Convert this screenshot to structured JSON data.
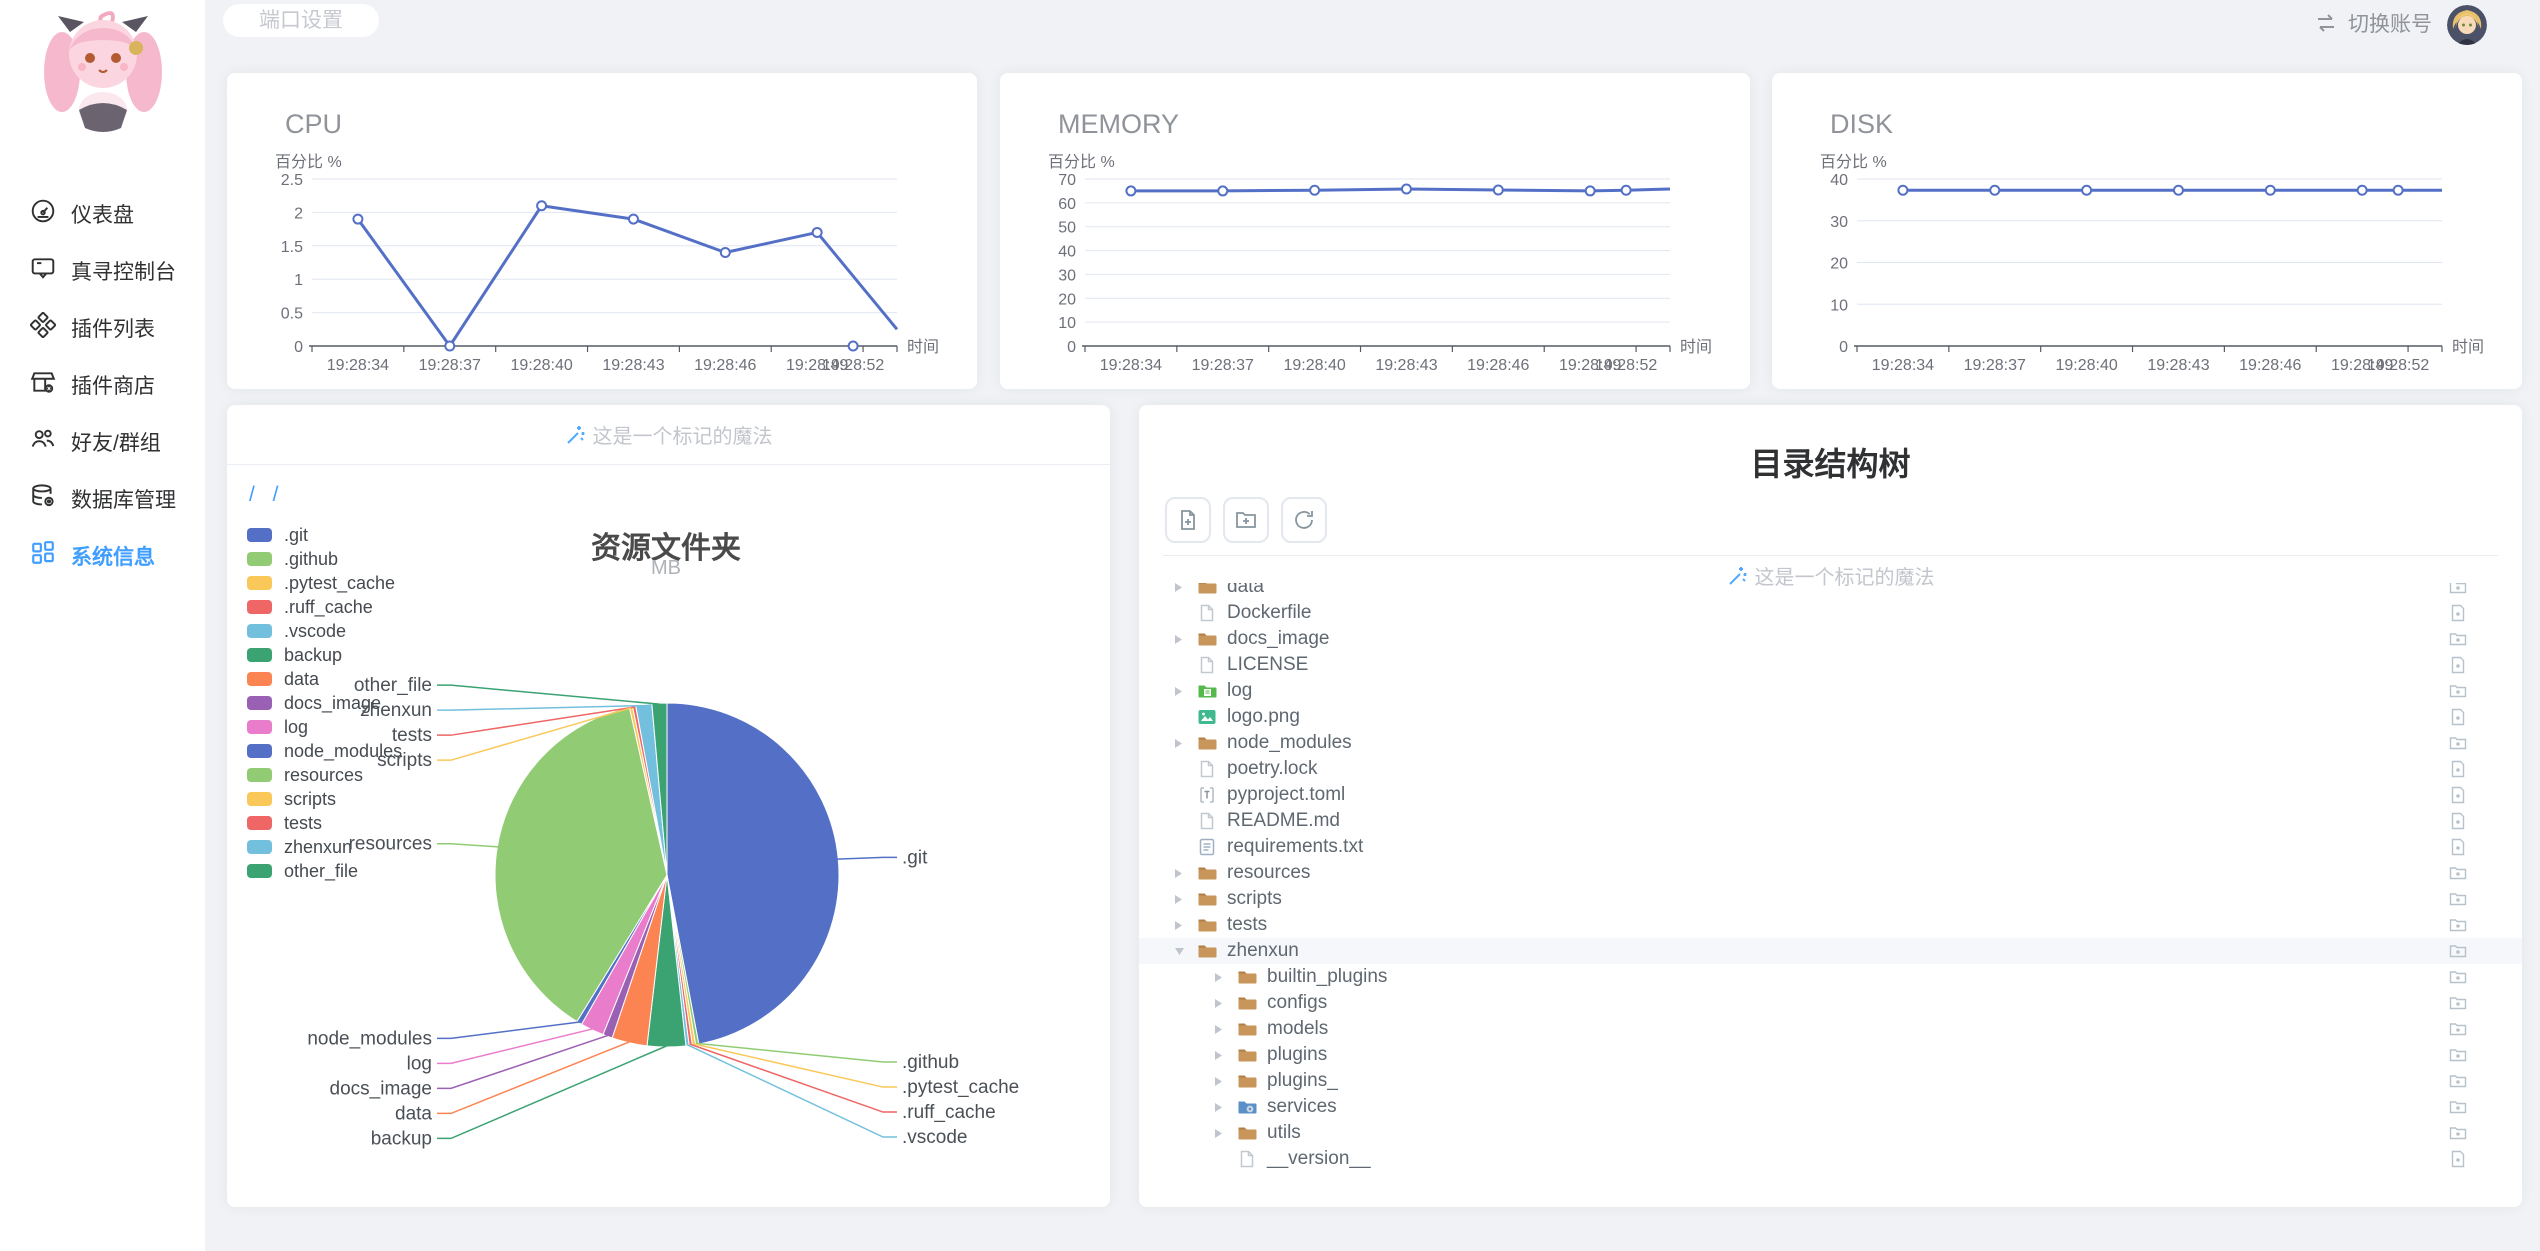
{
  "topbar": {
    "port_button": "端口设置",
    "switch_account": "切换账号"
  },
  "sidebar": {
    "items": [
      {
        "label": "仪表盘",
        "icon": "gauge-icon",
        "active": false
      },
      {
        "label": "真寻控制台",
        "icon": "console-icon",
        "active": false
      },
      {
        "label": "插件列表",
        "icon": "plugins-icon",
        "active": false
      },
      {
        "label": "插件商店",
        "icon": "store-icon",
        "active": false
      },
      {
        "label": "好友/群组",
        "icon": "friends-icon",
        "active": false
      },
      {
        "label": "数据库管理",
        "icon": "database-icon",
        "active": false
      },
      {
        "label": "系统信息",
        "icon": "grid-icon",
        "active": true
      }
    ]
  },
  "chart_data": [
    {
      "type": "line",
      "title": "CPU",
      "ylabel": "百分比 %",
      "xlabel": "时间",
      "x": [
        "19:28:34",
        "19:28:37",
        "19:28:40",
        "19:28:43",
        "19:28:46",
        "19:28:49",
        "19:28:52"
      ],
      "values": [
        1.9,
        0,
        2.1,
        1.9,
        1.4,
        1.7,
        0
      ],
      "ylim": [
        0,
        2.5
      ],
      "yticks": [
        0,
        0.5,
        1,
        1.5,
        2,
        2.5
      ],
      "x_fractions": [
        0.0785,
        0.2355,
        0.3925,
        0.5495,
        0.7065,
        0.8635,
        0.925
      ],
      "tick_fractions": [
        0,
        0.157,
        0.314,
        0.471,
        0.628,
        0.785,
        0.942,
        1
      ],
      "tail": {
        "f": 1,
        "v": 0.25
      },
      "detached_last": true,
      "color": "#5470c6",
      "grid": true,
      "legend_position": "none"
    },
    {
      "type": "line",
      "title": "MEMORY",
      "ylabel": "百分比 %",
      "xlabel": "时间",
      "x": [
        "19:28:34",
        "19:28:37",
        "19:28:40",
        "19:28:43",
        "19:28:46",
        "19:28:49",
        "19:28:52"
      ],
      "values": [
        65,
        65,
        65.3,
        65.8,
        65.4,
        65,
        65.3
      ],
      "ylim": [
        0,
        70
      ],
      "yticks": [
        0,
        10,
        20,
        30,
        40,
        50,
        60,
        70
      ],
      "x_fractions": [
        0.0785,
        0.2355,
        0.3925,
        0.5495,
        0.7065,
        0.8635,
        0.925
      ],
      "tick_fractions": [
        0,
        0.157,
        0.314,
        0.471,
        0.628,
        0.785,
        0.942,
        1
      ],
      "tail": {
        "f": 1,
        "v": 65.8
      },
      "detached_last": false,
      "color": "#5470c6",
      "grid": true,
      "legend_position": "none"
    },
    {
      "type": "line",
      "title": "DISK",
      "ylabel": "百分比 %",
      "xlabel": "时间",
      "x": [
        "19:28:34",
        "19:28:37",
        "19:28:40",
        "19:28:43",
        "19:28:46",
        "19:28:49",
        "19:28:52"
      ],
      "values": [
        37.3,
        37.3,
        37.3,
        37.3,
        37.3,
        37.3,
        37.3
      ],
      "ylim": [
        0,
        40
      ],
      "yticks": [
        0,
        10,
        20,
        30,
        40
      ],
      "x_fractions": [
        0.0785,
        0.2355,
        0.3925,
        0.5495,
        0.7065,
        0.8635,
        0.925
      ],
      "tick_fractions": [
        0,
        0.157,
        0.314,
        0.471,
        0.628,
        0.785,
        0.942,
        1
      ],
      "tail": {
        "f": 1,
        "v": 37.3
      },
      "detached_last": false,
      "color": "#5470c6",
      "grid": true,
      "legend_position": "none"
    },
    {
      "type": "pie",
      "title": "资源文件夹",
      "subtitle": "MB",
      "unit": "MB",
      "legend_position": "left",
      "items": [
        {
          "label": ".git",
          "value_pct": 46.9,
          "color": "#5470c6"
        },
        {
          "label": ".github",
          "value_pct": 0.3,
          "color": "#91cc75"
        },
        {
          "label": ".pytest_cache",
          "value_pct": 0.3,
          "color": "#fac858"
        },
        {
          "label": ".ruff_cache",
          "value_pct": 0.3,
          "color": "#ee6666"
        },
        {
          "label": ".vscode",
          "value_pct": 0.3,
          "color": "#73c0de"
        },
        {
          "label": "backup",
          "value_pct": 3.6,
          "color": "#3ba272"
        },
        {
          "label": "data",
          "value_pct": 3.3,
          "color": "#fc8452"
        },
        {
          "label": "docs_image",
          "value_pct": 0.9,
          "color": "#9a60b4"
        },
        {
          "label": "log",
          "value_pct": 2.2,
          "color": "#ea7ccc"
        },
        {
          "label": "node_modules",
          "value_pct": 0.5,
          "color": "#5470c6"
        },
        {
          "label": "resources",
          "value_pct": 37.6,
          "color": "#91cc75"
        },
        {
          "label": "scripts",
          "value_pct": 0.3,
          "color": "#fac858"
        },
        {
          "label": "tests",
          "value_pct": 0.3,
          "color": "#ee6666"
        },
        {
          "label": "zhenxun",
          "value_pct": 1.5,
          "color": "#73c0de"
        },
        {
          "label": "other_file",
          "value_pct": 1.4,
          "color": "#3ba272"
        }
      ]
    }
  ],
  "resource_card": {
    "marker_text": "这是一个标记的魔法",
    "breadcrumb": "/ /"
  },
  "tree_card": {
    "title": "目录结构树",
    "marker_text": "这是一个标记的魔法",
    "rows": [
      {
        "name": "data",
        "icon": "folder",
        "dir": true,
        "level": 0
      },
      {
        "name": "Dockerfile",
        "icon": "file",
        "dir": false,
        "level": 0
      },
      {
        "name": "docs_image",
        "icon": "folder",
        "dir": true,
        "level": 0
      },
      {
        "name": "LICENSE",
        "icon": "file",
        "dir": false,
        "level": 0
      },
      {
        "name": "log",
        "icon": "folder-log",
        "dir": true,
        "level": 0
      },
      {
        "name": "logo.png",
        "icon": "image",
        "dir": false,
        "level": 0
      },
      {
        "name": "node_modules",
        "icon": "folder",
        "dir": true,
        "level": 0
      },
      {
        "name": "poetry.lock",
        "icon": "file",
        "dir": false,
        "level": 0
      },
      {
        "name": "pyproject.toml",
        "icon": "toml",
        "dir": false,
        "level": 0
      },
      {
        "name": "README.md",
        "icon": "file",
        "dir": false,
        "level": 0
      },
      {
        "name": "requirements.txt",
        "icon": "txt",
        "dir": false,
        "level": 0
      },
      {
        "name": "resources",
        "icon": "folder",
        "dir": true,
        "level": 0
      },
      {
        "name": "scripts",
        "icon": "folder",
        "dir": true,
        "level": 0
      },
      {
        "name": "tests",
        "icon": "folder",
        "dir": true,
        "level": 0
      },
      {
        "name": "zhenxun",
        "icon": "folder",
        "dir": true,
        "level": 0,
        "expanded": true,
        "selected": true
      },
      {
        "name": "builtin_plugins",
        "icon": "folder",
        "dir": true,
        "level": 1
      },
      {
        "name": "configs",
        "icon": "folder",
        "dir": true,
        "level": 1
      },
      {
        "name": "models",
        "icon": "folder",
        "dir": true,
        "level": 1
      },
      {
        "name": "plugins",
        "icon": "folder",
        "dir": true,
        "level": 1
      },
      {
        "name": "plugins_",
        "icon": "folder",
        "dir": true,
        "level": 1
      },
      {
        "name": "services",
        "icon": "services",
        "dir": true,
        "level": 1
      },
      {
        "name": "utils",
        "icon": "folder",
        "dir": true,
        "level": 1
      },
      {
        "name": "__version__",
        "icon": "file",
        "dir": false,
        "level": 1
      }
    ]
  }
}
